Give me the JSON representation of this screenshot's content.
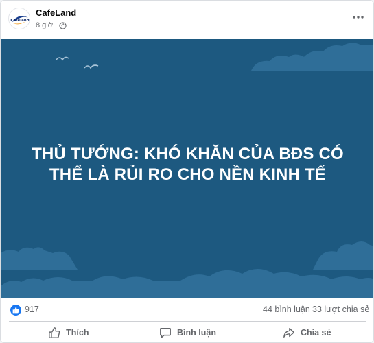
{
  "post": {
    "page_name": "CafeLand",
    "avatar_text": "Cafeland",
    "time": "8 giờ",
    "separator": "·",
    "audience_icon": "globe-icon",
    "more_icon": "more-horizontal-icon"
  },
  "image": {
    "headline_line1": "THỦ TƯỚNG: KHÓ KHĂN CỦA BĐS CÓ",
    "headline_line2": "THỂ LÀ RỦI RO CHO NỀN KINH TẾ",
    "colors": {
      "background": "#1d5980",
      "cloud": "#2f6e98",
      "text": "#ffffff"
    }
  },
  "stats": {
    "reaction_icon": "like-reaction-icon",
    "reaction_count": "917",
    "comments": "44 bình luận",
    "shares": "33 lượt chia sẻ"
  },
  "actions": {
    "like": "Thích",
    "comment": "Bình luận",
    "share": "Chia sẻ"
  },
  "colors": {
    "accent": "#1877f2",
    "muted": "#65676b"
  }
}
